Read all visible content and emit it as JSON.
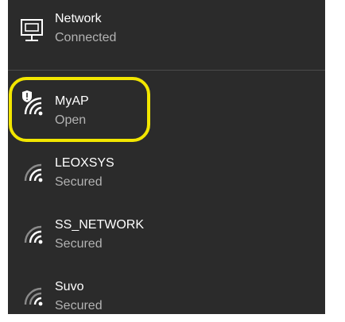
{
  "ethernet": {
    "name": "Network",
    "status": "Connected",
    "icon": "ethernet-network-icon"
  },
  "networks": [
    {
      "ssid": "MyAP",
      "status": "Open",
      "icon": "wifi-shield-warning-icon",
      "highlighted": true
    },
    {
      "ssid": "LEOXSYS",
      "status": "Secured",
      "icon": "wifi-signal-icon"
    },
    {
      "ssid": "SS_NETWORK",
      "status": "Secured",
      "icon": "wifi-signal-icon"
    },
    {
      "ssid": "Suvo",
      "status": "Secured",
      "icon": "wifi-signal-icon"
    }
  ],
  "colors": {
    "panel_bg": "#2b2b2b",
    "text_primary": "#ffffff",
    "text_secondary": "#b3b3b3",
    "highlight": "#f2e600"
  }
}
